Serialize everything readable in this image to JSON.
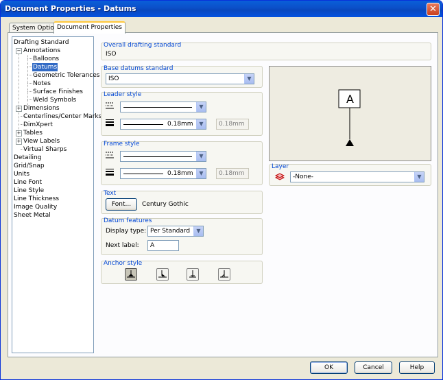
{
  "window": {
    "title": "Document Properties - Datums"
  },
  "tabs": [
    {
      "label": "System Options"
    },
    {
      "label": "Document Properties"
    }
  ],
  "tree": {
    "items": [
      "Drafting Standard",
      "Annotations",
      "Balloons",
      "Datums",
      "Geometric Tolerances",
      "Notes",
      "Surface Finishes",
      "Weld Symbols",
      "Dimensions",
      "Centerlines/Center Marks",
      "DimXpert",
      "Tables",
      "View Labels",
      "Virtual Sharps",
      "Detailing",
      "Grid/Snap",
      "Units",
      "Line Font",
      "Line Style",
      "Line Thickness",
      "Image Quality",
      "Sheet Metal"
    ],
    "expander_collapse": "−",
    "expander_expand": "+"
  },
  "overall": {
    "title": "Overall drafting standard",
    "value": "ISO"
  },
  "base": {
    "title": "Base datums standard",
    "value": "ISO"
  },
  "leader": {
    "title": "Leader style",
    "thickness": "0.18mm",
    "custom": "0.18mm"
  },
  "frame": {
    "title": "Frame style",
    "thickness": "0.18mm",
    "custom": "0.18mm"
  },
  "text": {
    "title": "Text",
    "font_button": "Font...",
    "font_name": "Century Gothic"
  },
  "datum_features": {
    "title": "Datum features",
    "display_label": "Display type:",
    "display_value": "Per Standard",
    "next_label": "Next label:",
    "next_value": "A"
  },
  "anchor": {
    "title": "Anchor style"
  },
  "layer": {
    "title": "Layer",
    "value": "-None-"
  },
  "preview": {
    "datum_letter": "A"
  },
  "buttons": {
    "ok": "OK",
    "cancel": "Cancel",
    "help": "Help"
  },
  "colors": {
    "accent": "#0046d5",
    "selection": "#316ac5",
    "title_bar": "#0a5fd9"
  }
}
